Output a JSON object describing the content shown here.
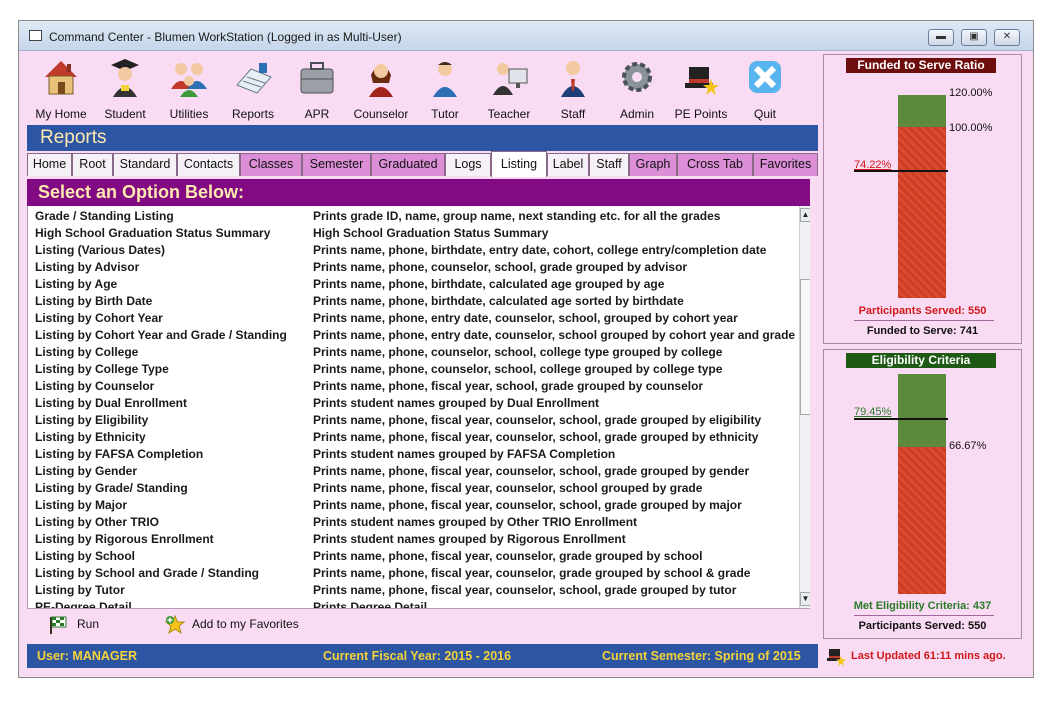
{
  "window": {
    "title": "Command Center - Blumen WorkStation (Logged in as Multi-User)",
    "controls": [
      "minimize",
      "restore",
      "close"
    ]
  },
  "toolbar": [
    {
      "label": "My Home",
      "icon": "house-icon"
    },
    {
      "label": "Student",
      "icon": "graduate-icon"
    },
    {
      "label": "Utilities",
      "icon": "people-group-icon"
    },
    {
      "label": "Reports",
      "icon": "report-sheet-icon"
    },
    {
      "label": "APR",
      "icon": "briefcase-icon"
    },
    {
      "label": "Counselor",
      "icon": "counselor-person-icon"
    },
    {
      "label": "Tutor",
      "icon": "tutor-person-icon"
    },
    {
      "label": "Teacher",
      "icon": "teacher-monitor-icon"
    },
    {
      "label": "Staff",
      "icon": "staff-person-icon"
    },
    {
      "label": "Admin",
      "icon": "gear-icon"
    },
    {
      "label": "PE Points",
      "icon": "magic-hat-star-icon"
    },
    {
      "label": "Quit",
      "icon": "blue-x-icon"
    }
  ],
  "section_title": "Reports",
  "tabs": [
    {
      "label": "Home",
      "style": "plain"
    },
    {
      "label": "Root",
      "style": "plain"
    },
    {
      "label": "Standard",
      "style": "plain"
    },
    {
      "label": "Contacts",
      "style": "plain"
    },
    {
      "label": "Classes",
      "style": "purple"
    },
    {
      "label": "Semester",
      "style": "purple"
    },
    {
      "label": "Graduated",
      "style": "purple"
    },
    {
      "label": "Logs",
      "style": "plain"
    },
    {
      "label": "Listing",
      "style": "active"
    },
    {
      "label": "Label",
      "style": "plain"
    },
    {
      "label": "Staff",
      "style": "plain"
    },
    {
      "label": "Graph",
      "style": "purple"
    },
    {
      "label": "Cross Tab",
      "style": "purple"
    },
    {
      "label": "Favorites",
      "style": "purple"
    }
  ],
  "select_header": "Select an Option Below:",
  "reports": [
    {
      "name": "Grade / Standing Listing",
      "description": "Prints grade ID, name, group name, next standing etc. for all the grades"
    },
    {
      "name": "High School Graduation Status Summary",
      "description": "High School Graduation Status Summary"
    },
    {
      "name": "Listing (Various Dates)",
      "description": "Prints name, phone, birthdate, entry date, cohort, college entry/completion date"
    },
    {
      "name": "Listing by Advisor",
      "description": "Prints name, phone, counselor, school, grade grouped by advisor"
    },
    {
      "name": "Listing by Age",
      "description": "Prints name, phone, birthdate, calculated age grouped by age"
    },
    {
      "name": "Listing by Birth Date",
      "description": "Prints name, phone, birthdate, calculated age sorted by birthdate"
    },
    {
      "name": "Listing by Cohort Year",
      "description": "Prints name, phone, entry date, counselor, school, grouped by cohort year"
    },
    {
      "name": "Listing by Cohort Year and Grade / Standing",
      "description": "Prints name, phone, entry date, counselor, school grouped by cohort year and grade"
    },
    {
      "name": "Listing by College",
      "description": "Prints name, phone, counselor, school, college type grouped by college"
    },
    {
      "name": "Listing by College Type",
      "description": "Prints name, phone, counselor, school, college grouped by college type"
    },
    {
      "name": "Listing by Counselor",
      "description": "Prints name, phone, fiscal year, school, grade grouped by counselor"
    },
    {
      "name": "Listing by Dual Enrollment",
      "description": "Prints student names grouped by Dual Enrollment"
    },
    {
      "name": "Listing by Eligibility",
      "description": "Prints name, phone, fiscal year, counselor, school, grade grouped by eligibility"
    },
    {
      "name": "Listing by Ethnicity",
      "description": "Prints name, phone, fiscal year, counselor, school, grade grouped by ethnicity"
    },
    {
      "name": "Listing by FAFSA Completion",
      "description": "Prints student names grouped by FAFSA Completion"
    },
    {
      "name": "Listing by Gender",
      "description": "Prints name, phone, fiscal year, counselor, school, grade grouped by gender"
    },
    {
      "name": "Listing by Grade/ Standing",
      "description": "Prints name, phone, fiscal year, counselor, school grouped by grade"
    },
    {
      "name": "Listing by Major",
      "description": "Prints name, phone, fiscal year, counselor, school, grade grouped by major"
    },
    {
      "name": "Listing by Other TRIO",
      "description": "Prints student names grouped by Other TRIO Enrollment"
    },
    {
      "name": "Listing by Rigorous Enrollment",
      "description": "Prints student names grouped by Rigorous Enrollment"
    },
    {
      "name": "Listing by School",
      "description": "Prints name, phone, fiscal year, counselor, grade grouped by school"
    },
    {
      "name": "Listing by School and Grade / Standing",
      "description": "Prints name, phone, fiscal year, counselor, grade grouped by school & grade"
    },
    {
      "name": "Listing by Tutor",
      "description": "Prints name, phone, fiscal year, counselor, school, grade grouped by tutor"
    },
    {
      "name": "PE-Degree Detail",
      "description": "Prints Degree Detail"
    }
  ],
  "actions": {
    "run": "Run",
    "add_favorites": "Add to my Favorites"
  },
  "status": {
    "user": "User: MANAGER",
    "fiscal_year": "Current Fiscal Year: 2015 - 2016",
    "semester": "Current Semester: Spring of 2015",
    "last_updated": "Last Updated 61:11 mins ago."
  },
  "funded_gauge": {
    "title": "Funded to Serve Ratio",
    "title_bg": "#6e0d0d",
    "title_color": "#ffffff",
    "value_label": "74.22%",
    "value": 74.22,
    "tick_high": "120.00%",
    "tick_mid": "100.00%",
    "participants_served": "Participants Served: 550",
    "funded_to_serve": "Funded to Serve: 741"
  },
  "eligibility_gauge": {
    "title": "Eligibility Criteria",
    "title_bg": "#1e5a14",
    "title_color": "#ffffff",
    "value_label": "79.45%",
    "value": 79.45,
    "threshold_label": "66.67%",
    "met_criteria": "Met Eligibility Criteria: 437",
    "participants_served": "Participants Served: 550"
  },
  "colors": {
    "window_bg": "#f9dcf4",
    "header_blue": "#2c56a3",
    "header_text": "#ffe9b0",
    "select_header_bg": "#820a82",
    "status_text": "#f5d23a",
    "gauge_red": "#d9452c",
    "gauge_green": "#5c8a3c"
  }
}
